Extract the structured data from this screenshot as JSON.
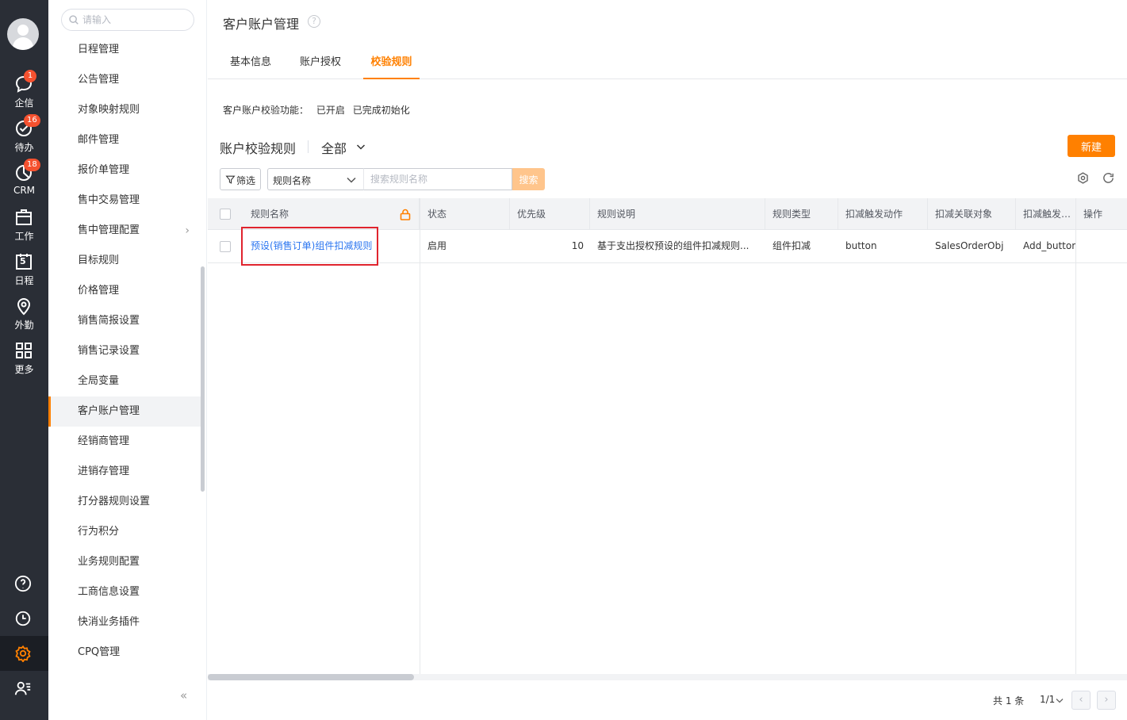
{
  "nav": {
    "items": [
      {
        "label": "企信",
        "icon": "chat-icon",
        "badge": "1"
      },
      {
        "label": "待办",
        "icon": "check-circle-icon",
        "badge": "16"
      },
      {
        "label": "CRM",
        "icon": "pie-chart-icon",
        "badge": "18"
      },
      {
        "label": "工作",
        "icon": "briefcase-icon",
        "badge": ""
      },
      {
        "label": "日程",
        "icon": "calendar-icon",
        "badge": "",
        "day": "5"
      },
      {
        "label": "外勤",
        "icon": "location-pin-icon",
        "badge": ""
      },
      {
        "label": "更多",
        "icon": "grid-icon",
        "badge": ""
      }
    ],
    "bottom": [
      "help-icon",
      "clock-icon",
      "gear-icon",
      "user-list-icon"
    ]
  },
  "menu": {
    "search_placeholder": "请输入",
    "items": [
      "日程管理",
      "公告管理",
      "对象映射规则",
      "邮件管理",
      "报价单管理",
      "售中交易管理",
      "售中管理配置",
      "目标规则",
      "价格管理",
      "销售简报设置",
      "销售记录设置",
      "全局变量",
      "客户账户管理",
      "经销商管理",
      "进销存管理",
      "打分器规则设置",
      "行为积分",
      "业务规则配置",
      "工商信息设置",
      "快消业务插件",
      "CPQ管理"
    ],
    "active_index": 12,
    "collapse_label": "«"
  },
  "page": {
    "title": "客户账户管理",
    "help": "?",
    "tabs": [
      "基本信息",
      "账户授权",
      "校验规则"
    ],
    "active_tab": 2,
    "status_label": "客户账户校验功能：",
    "status_values": [
      "已开启",
      "已完成初始化"
    ],
    "section_title": "账户校验规则",
    "scope": "全部",
    "new_button": "新建",
    "filter_button": "筛选",
    "field_select": "规则名称",
    "search_placeholder": "搜索规则名称",
    "search_button": "搜索"
  },
  "table": {
    "columns": [
      "规则名称",
      "状态",
      "优先级",
      "规则说明",
      "规则类型",
      "扣减触发动作",
      "扣减关联对象",
      "扣减触发按钮",
      "操作"
    ],
    "rows": [
      [
        "预设(销售订单)组件扣减规则",
        "启用",
        "10",
        "基于支出授权预设的组件扣减规则...",
        "组件扣减",
        "button",
        "SalesOrderObj",
        "Add_button_",
        ""
      ]
    ]
  },
  "pager": {
    "total": "共 1 条",
    "page": "1/1",
    "prev": "‹",
    "next": "›"
  },
  "colors": {
    "accent": "#ff8000",
    "nav_bg": "#2a2e36",
    "link": "#2b76f0",
    "badge": "#f5512f",
    "highlight_box": "#e0242e"
  }
}
